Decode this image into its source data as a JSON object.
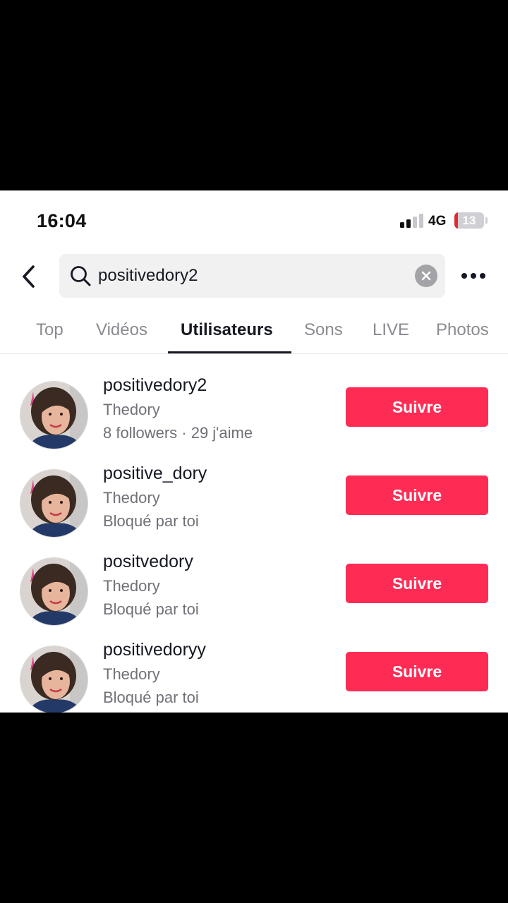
{
  "status_bar": {
    "time": "16:04",
    "network": "4G",
    "battery": "13",
    "battery_level": 0.13
  },
  "search": {
    "query": "positivedory2",
    "icon": "search-icon",
    "clear_icon": "clear-icon"
  },
  "header": {
    "back_icon": "chevron-left-icon",
    "more_icon": "more-horizontal-icon"
  },
  "tabs": [
    {
      "label": "Top"
    },
    {
      "label": "Vidéos"
    },
    {
      "label": "Utilisateurs",
      "active": true
    },
    {
      "label": "Sons"
    },
    {
      "label": "LIVE"
    },
    {
      "label": "Photos"
    }
  ],
  "users": [
    {
      "username": "positivedory2",
      "nickname": "Thedory",
      "meta": "8 followers · 29 j'aime",
      "follow_label": "Suivre"
    },
    {
      "username": "positive_dory",
      "nickname": "Thedory",
      "meta": "Bloqué par toi",
      "follow_label": "Suivre"
    },
    {
      "username": "positvedory",
      "nickname": "Thedory",
      "meta": "Bloqué par toi",
      "follow_label": "Suivre"
    },
    {
      "username": "positivedoryy",
      "nickname": "Thedory",
      "meta": "Bloqué par toi",
      "follow_label": "Suivre"
    }
  ],
  "colors": {
    "accent": "#fe2c55",
    "text_primary": "#161823",
    "text_secondary": "#707178",
    "tab_inactive": "#8a8b91",
    "search_bg": "#f1f1f2",
    "battery_low": "#e5262f"
  }
}
